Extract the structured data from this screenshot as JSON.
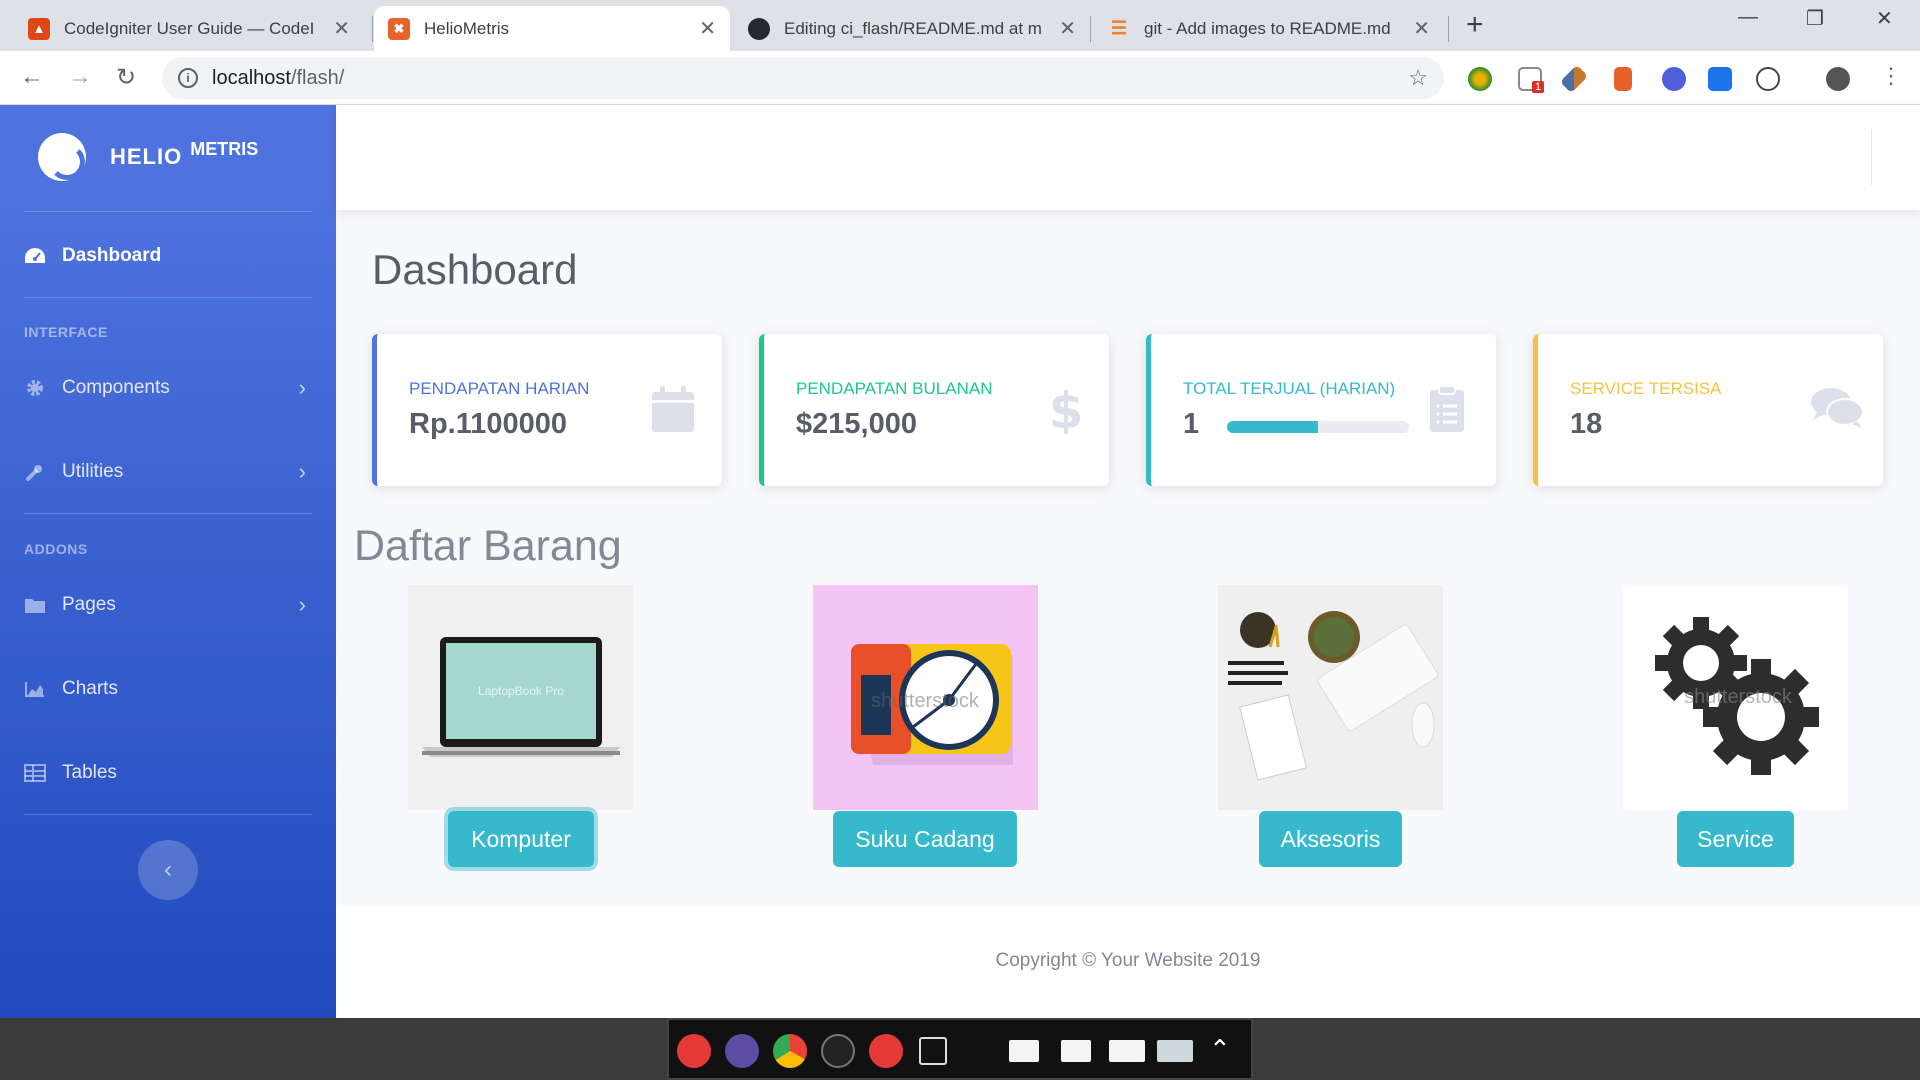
{
  "browser": {
    "tabs": [
      {
        "title": "CodeIgniter User Guide — CodeI",
        "active": false
      },
      {
        "title": "HelioMetris",
        "active": true
      },
      {
        "title": "Editing ci_flash/README.md at m",
        "active": false
      },
      {
        "title": "git - Add images to README.md",
        "active": false
      }
    ],
    "url_host": "localhost",
    "url_path": "/flash/",
    "extension_badge": "1"
  },
  "brand": {
    "name": "HELIO",
    "sup": "METRIS"
  },
  "sidebar": {
    "dashboard": "Dashboard",
    "heading_interface": "INTERFACE",
    "components": "Components",
    "utilities": "Utilities",
    "heading_addons": "ADDONS",
    "pages": "Pages",
    "charts": "Charts",
    "tables": "Tables"
  },
  "page": {
    "title": "Dashboard",
    "section": "Daftar Barang"
  },
  "cards": [
    {
      "label": "PENDAPATAN HARIAN",
      "value": "Rp.1100000",
      "color": "#4e73df",
      "icon": "calendar-icon"
    },
    {
      "label": "PENDAPATAN BULANAN",
      "value": "$215,000",
      "color": "#1cc88a",
      "icon": "dollar-icon"
    },
    {
      "label": "TOTAL TERJUAL (HARIAN)",
      "value": "1",
      "color": "#36b9cc",
      "icon": "clipboard-icon",
      "progress": 0.5
    },
    {
      "label": "SERVICE TERSISA",
      "value": "18",
      "color": "#f6c23e",
      "icon": "comments-icon"
    }
  ],
  "products": [
    {
      "label": "Komputer",
      "image": "laptop-image",
      "screen_text": "LaptopBook Pro"
    },
    {
      "label": "Suku Cadang",
      "image": "hard-disk-image",
      "watermark": "shutterstock"
    },
    {
      "label": "Aksesoris",
      "image": "desk-accessories-image"
    },
    {
      "label": "Service",
      "image": "gears-image",
      "watermark": "shutterstock"
    }
  ],
  "footer": {
    "copyright": "Copyright © Your Website 2019"
  }
}
